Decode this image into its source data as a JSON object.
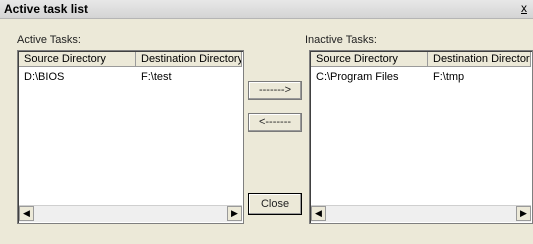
{
  "window": {
    "title": "Active task list",
    "close_label": "x"
  },
  "active": {
    "label": "Active Tasks:",
    "columns": [
      "Source Directory",
      "Destination Directory"
    ],
    "rows": [
      [
        "D:\\BIOS",
        "F:\\test"
      ]
    ]
  },
  "inactive": {
    "label": "Inactive Tasks:",
    "columns": [
      "Source Directory",
      "Destination Directory"
    ],
    "rows": [
      [
        "C:\\Program Files",
        "F:\\tmp"
      ]
    ]
  },
  "buttons": {
    "move_right": "------->",
    "move_left": "<-------",
    "close": "Close"
  },
  "scroll": {
    "left_arrow": "◀",
    "right_arrow": "▶"
  }
}
